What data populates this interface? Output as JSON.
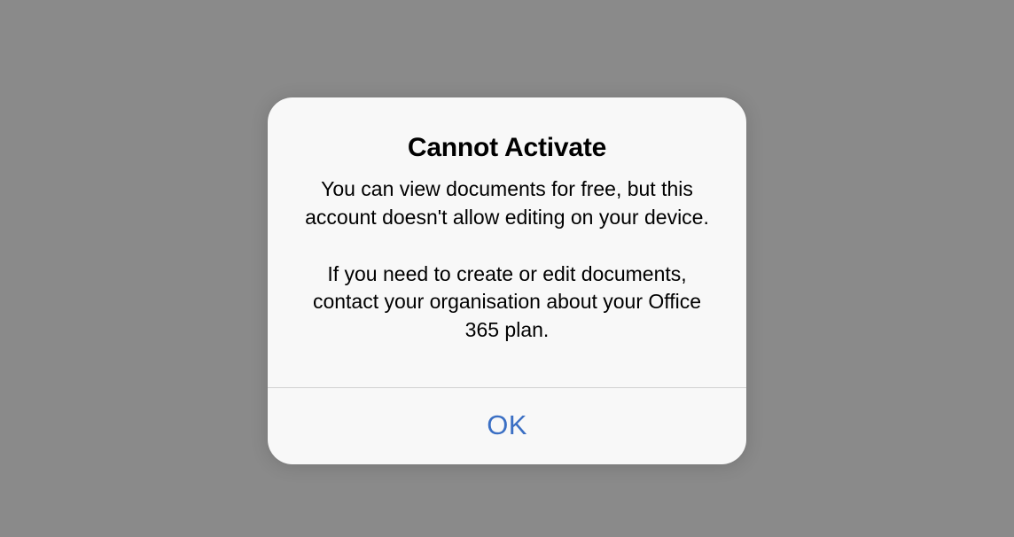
{
  "dialog": {
    "title": "Cannot Activate",
    "message_line1": "You can view documents for free, but this account doesn't allow editing on your device.",
    "message_line2": "If you need to create or edit documents, contact your organisation about your Office 365 plan.",
    "ok_label": "OK"
  }
}
